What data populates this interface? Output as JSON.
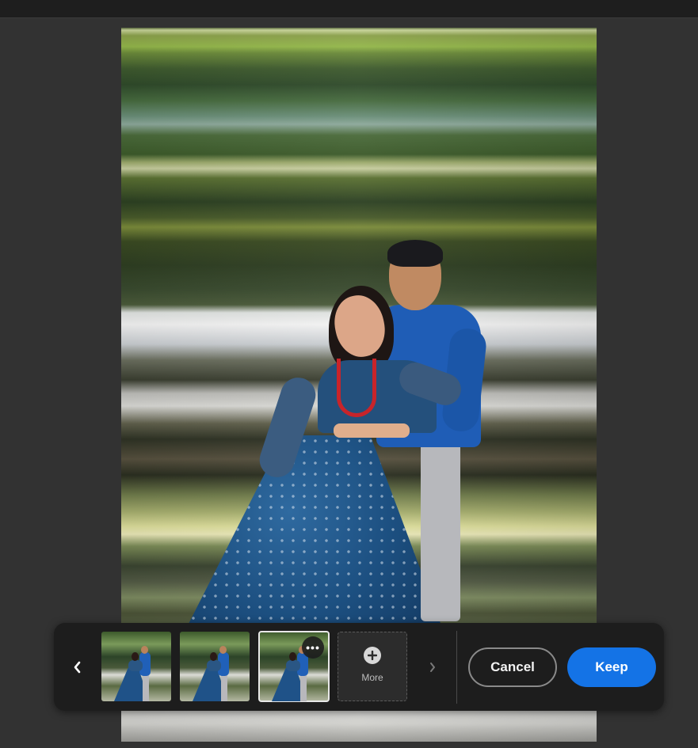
{
  "filmstrip": {
    "prev_icon": "chevron-left-icon",
    "next_icon": "chevron-right-icon",
    "thumbnails": [
      {
        "selected": false
      },
      {
        "selected": false
      },
      {
        "selected": true,
        "options_icon": "more-options-icon",
        "options_glyph": "•••"
      }
    ],
    "more_tile": {
      "icon": "plus-circle-icon",
      "label": "More"
    }
  },
  "actions": {
    "cancel_label": "Cancel",
    "keep_label": "Keep"
  },
  "colors": {
    "background": "#323232",
    "panel": "#1d1d1d",
    "accent": "#1473e6"
  }
}
